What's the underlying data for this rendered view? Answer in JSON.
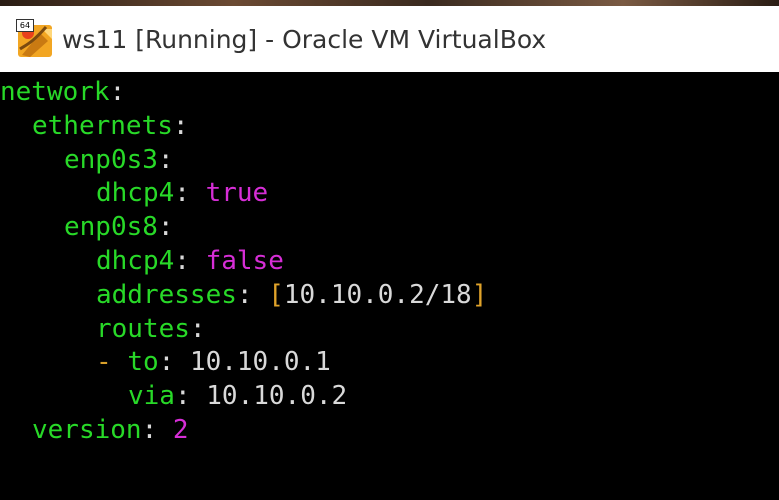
{
  "window": {
    "title": "ws11 [Running] - Oracle VM VirtualBox",
    "icon": "virtualbox-icon",
    "badge": "64"
  },
  "terminal": {
    "lines": [
      {
        "key": "network",
        "sep": ":"
      },
      {
        "key": "ethernets",
        "sep": ":"
      },
      {
        "key": "enp0s3",
        "sep": ":"
      },
      {
        "key": "dhcp4",
        "sep": ": ",
        "value": "true"
      },
      {
        "key": "enp0s8",
        "sep": ":"
      },
      {
        "key": "dhcp4",
        "sep": ": ",
        "value": "false"
      },
      {
        "key": "addresses",
        "sep": ": ",
        "open": "[",
        "value": "10.10.0.2/18",
        "close": "]"
      },
      {
        "key": "routes",
        "sep": ":"
      },
      {
        "dash": "- ",
        "key": "to",
        "sep": ": ",
        "value": "10.10.0.1"
      },
      {
        "key": "via",
        "sep": ": ",
        "value": "10.10.0.2"
      },
      {
        "key": "version",
        "sep": ": ",
        "value": "2"
      }
    ]
  },
  "colors": {
    "key": "#28d928",
    "boolean": "#d62ed6",
    "bracket": "#e0a32a",
    "text": "#d9d9d9",
    "background": "#000000"
  }
}
